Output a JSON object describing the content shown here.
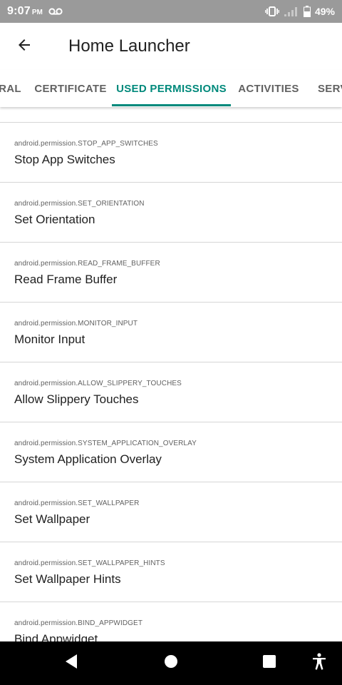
{
  "status_bar": {
    "time": "9:07",
    "ampm": "PM",
    "battery": "49%",
    "icons": [
      "voicemail-icon",
      "vibrate-icon",
      "signal-icon",
      "battery-icon"
    ]
  },
  "app_bar": {
    "title": "Home Launcher",
    "back_icon": "arrow-back-icon"
  },
  "tabs": [
    {
      "label": "RAL",
      "active": false
    },
    {
      "label": "CERTIFICATE",
      "active": false
    },
    {
      "label": "USED PERMISSIONS",
      "active": true
    },
    {
      "label": "ACTIVITIES",
      "active": false
    },
    {
      "label": "SERV",
      "active": false
    }
  ],
  "permissions": [
    {
      "id": "android.permission.STOP_APP_SWITCHES",
      "name": "Stop App Switches"
    },
    {
      "id": "android.permission.SET_ORIENTATION",
      "name": "Set Orientation"
    },
    {
      "id": "android.permission.READ_FRAME_BUFFER",
      "name": "Read Frame Buffer"
    },
    {
      "id": "android.permission.MONITOR_INPUT",
      "name": "Monitor Input"
    },
    {
      "id": "android.permission.ALLOW_SLIPPERY_TOUCHES",
      "name": "Allow Slippery Touches"
    },
    {
      "id": "android.permission.SYSTEM_APPLICATION_OVERLAY",
      "name": "System Application Overlay"
    },
    {
      "id": "android.permission.SET_WALLPAPER",
      "name": "Set Wallpaper"
    },
    {
      "id": "android.permission.SET_WALLPAPER_HINTS",
      "name": "Set Wallpaper Hints"
    },
    {
      "id": "android.permission.BIND_APPWIDGET",
      "name": "Bind Appwidget"
    }
  ],
  "nav_bar": {
    "buttons": [
      "back-triangle-icon",
      "home-circle-icon",
      "recents-square-icon",
      "accessibility-icon"
    ]
  },
  "colors": {
    "accent": "#00897b",
    "status_bar": "#9a9a9a",
    "nav_bar": "#000000"
  }
}
